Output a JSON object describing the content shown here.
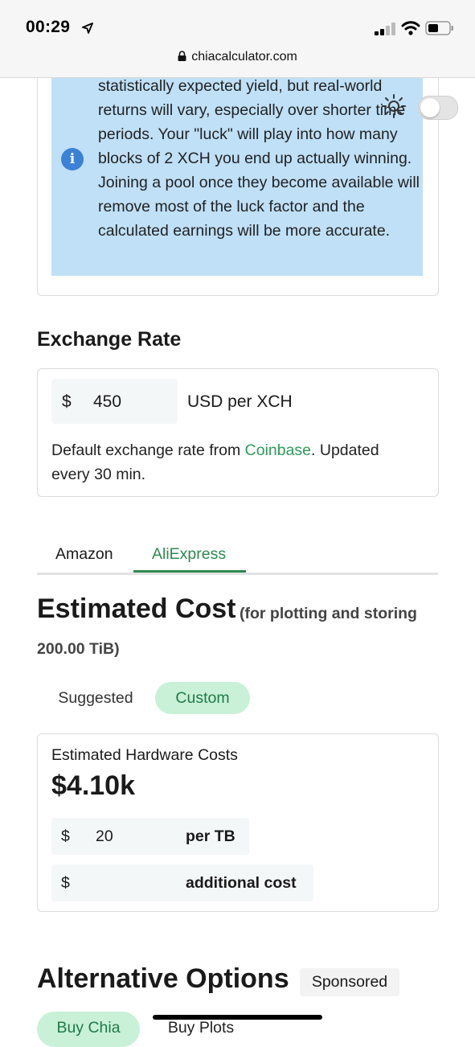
{
  "status_bar": {
    "time": "00:29",
    "url": "chiacalculator.com"
  },
  "info": {
    "text": "statistically expected yield, but real-world returns will vary, especially over shorter time periods. Your \"luck\" will play into how many blocks of 2 XCH you end up actually winning. Joining a pool once they become available will remove most of the luck factor and the calculated earnings will be more accurate.",
    "icon_letter": "i"
  },
  "exchange": {
    "heading": "Exchange Rate",
    "currency_symbol": "$",
    "value": "450",
    "unit": "USD per XCH",
    "note_prefix": "Default exchange rate from ",
    "note_link": "Coinbase",
    "note_suffix": ". Updated every 30 min."
  },
  "tabs": {
    "amazon": "Amazon",
    "aliexpress": "AliExpress",
    "active": "AliExpress"
  },
  "estimated_cost": {
    "heading": "Estimated Cost",
    "sub_line1": "(for plotting and storing",
    "sub_line2": "200.00 TiB)",
    "suggested": "Suggested",
    "custom": "Custom",
    "selected": "Custom"
  },
  "hardware": {
    "title": "Estimated Hardware Costs",
    "total": "$4.10k",
    "rows": [
      {
        "currency": "$",
        "value": "20",
        "label": "per TB"
      },
      {
        "currency": "$",
        "value": "",
        "label": "additional cost"
      }
    ]
  },
  "alternatives": {
    "heading": "Alternative Options",
    "badge": "Sponsored",
    "buy_chia": "Buy Chia",
    "buy_plots": "Buy Plots"
  },
  "colors": {
    "accent_green": "#2e8a4f",
    "pill_green_bg": "#c9f1d8",
    "info_blue_bg": "#bfe0f7",
    "info_icon_blue": "#3b82d6"
  }
}
